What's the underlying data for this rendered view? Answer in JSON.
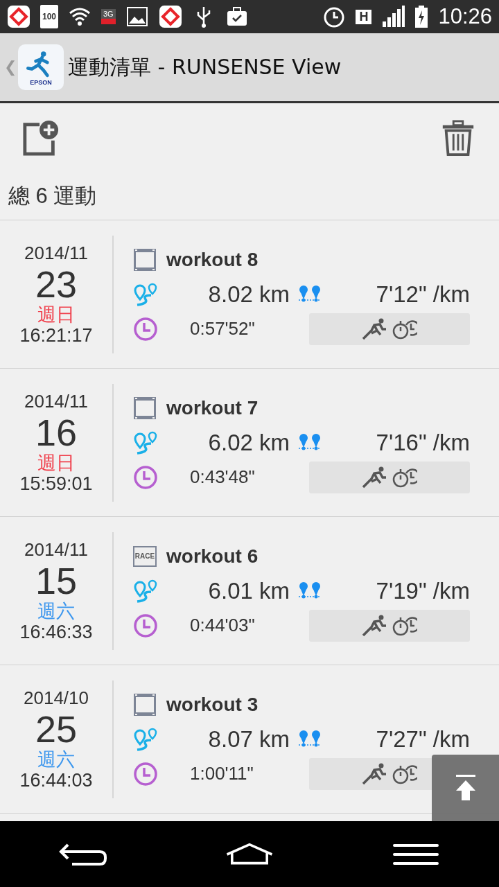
{
  "status_bar": {
    "battery_text": "100",
    "network_text": "3G",
    "data_text": "H",
    "time": "10:26"
  },
  "action_bar": {
    "back": "❮",
    "title": "運動清單 - RUNSENSE View",
    "logo_text": "EPSON"
  },
  "summary": "總 6 運動",
  "workouts": [
    {
      "month": "2014/11",
      "day": "23",
      "weekday": "週日",
      "color": "#f0434f",
      "time": "16:21:17",
      "kind": "film",
      "name": "workout 8",
      "distance": "8.02 km",
      "pace": "7'12\" /km",
      "duration": "0:57'52\""
    },
    {
      "month": "2014/11",
      "day": "16",
      "weekday": "週日",
      "color": "#f0434f",
      "time": "15:59:01",
      "kind": "film",
      "name": "workout 7",
      "distance": "6.02 km",
      "pace": "7'16\" /km",
      "duration": "0:43'48\""
    },
    {
      "month": "2014/11",
      "day": "15",
      "weekday": "週六",
      "color": "#3d97ee",
      "time": "16:46:33",
      "kind": "race",
      "kind_label": "RACE",
      "name": "workout 6",
      "distance": "6.01 km",
      "pace": "7'19\" /km",
      "duration": "0:44'03\""
    },
    {
      "month": "2014/10",
      "day": "25",
      "weekday": "週六",
      "color": "#3d97ee",
      "time": "16:44:03",
      "kind": "film",
      "name": "workout 3",
      "distance": "8.07 km",
      "pace": "7'27\" /km",
      "duration": "1:00'11\""
    }
  ]
}
